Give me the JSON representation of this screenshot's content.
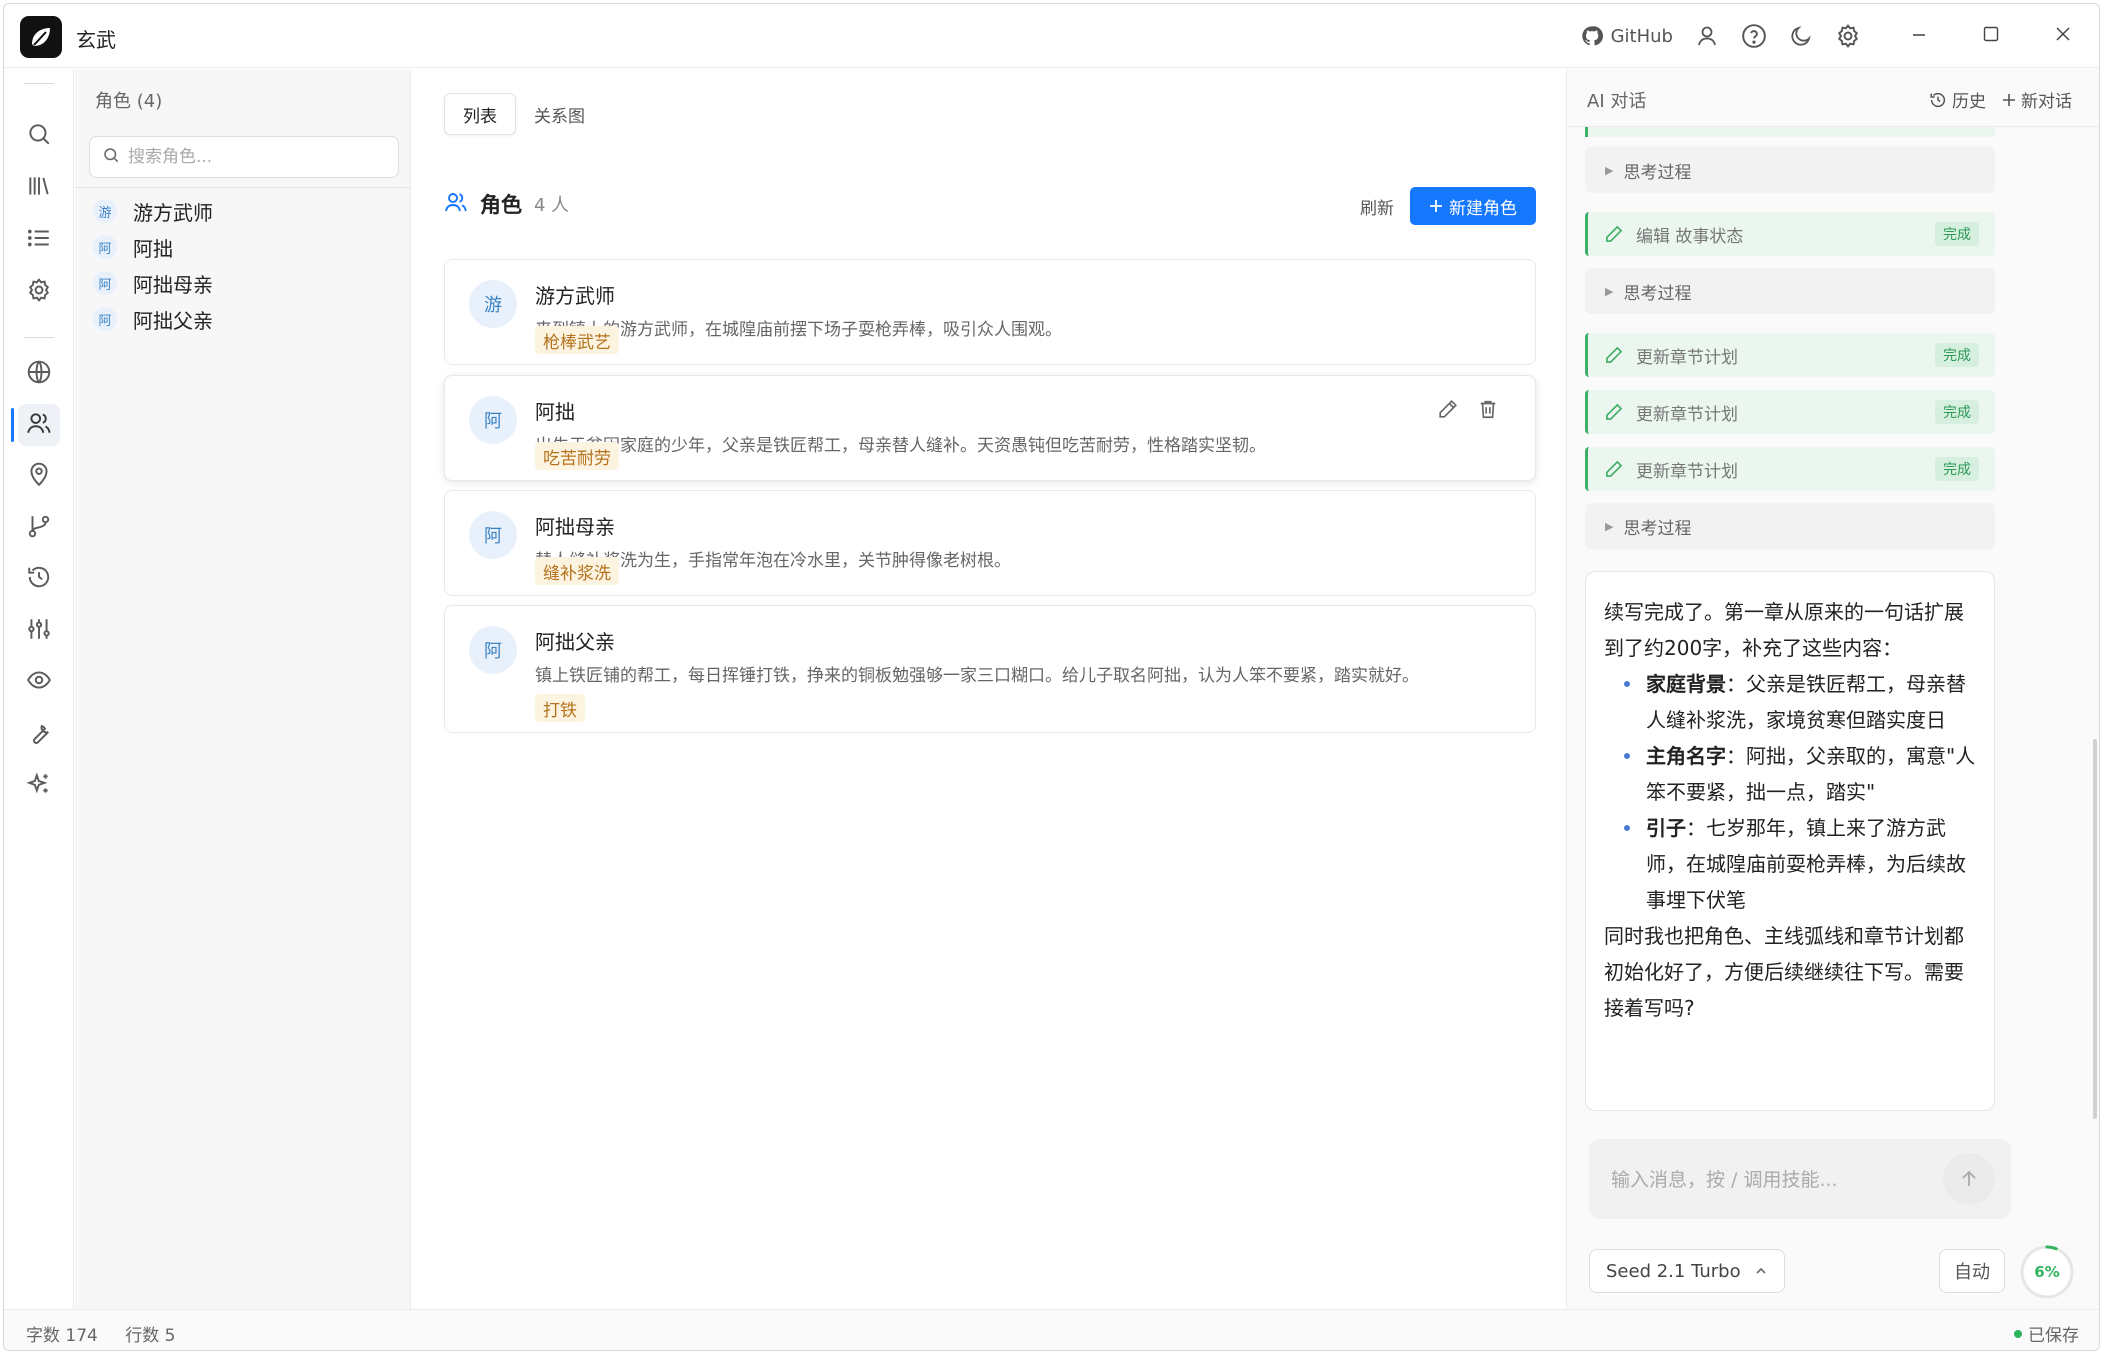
{
  "app": {
    "title": "玄武"
  },
  "titlebar": {
    "github_label": "GitHub"
  },
  "character_list": {
    "header": "角色 (4)",
    "search_placeholder": "搜索角色...",
    "items": [
      {
        "avatar": "游",
        "name": "游方武师"
      },
      {
        "avatar": "阿",
        "name": "阿拙"
      },
      {
        "avatar": "阿",
        "name": "阿拙母亲"
      },
      {
        "avatar": "阿",
        "name": "阿拙父亲"
      }
    ]
  },
  "main": {
    "tabs": [
      {
        "label": "列表",
        "active": true
      },
      {
        "label": "关系图",
        "active": false
      }
    ],
    "section_title": "角色",
    "section_count": "4 人",
    "refresh_label": "刷新",
    "new_button_label": "新建角色",
    "cards": [
      {
        "avatar": "游",
        "name": "游方武师",
        "desc": "来到镇上的游方武师，在城隍庙前摆下场子耍枪弄棒，吸引众人围观。",
        "tag": "枪棒武艺"
      },
      {
        "avatar": "阿",
        "name": "阿拙",
        "desc": "出生于贫困家庭的少年，父亲是铁匠帮工，母亲替人缝补。天资愚钝但吃苦耐劳，性格踏实坚韧。",
        "tag": "吃苦耐劳"
      },
      {
        "avatar": "阿",
        "name": "阿拙母亲",
        "desc": "替人缝补浆洗为生，手指常年泡在冷水里，关节肿得像老树根。",
        "tag": "缝补浆洗"
      },
      {
        "avatar": "阿",
        "name": "阿拙父亲",
        "desc": "镇上铁匠铺的帮工，每日挥锤打铁，挣来的铜板勉强够一家三口糊口。给儿子取名阿拙，认为人笨不要紧，踏实就好。",
        "tag": "打铁"
      }
    ]
  },
  "ai": {
    "title": "AI 对话",
    "history_label": "历史",
    "new_chat_label": "新对话",
    "think_label": "思考过程",
    "done_label": "完成",
    "tool_edit_story": "编辑 故事状态",
    "tool_update_chapter": "更新章节计划",
    "message": {
      "intro": "续写完成了。第一章从原来的一句话扩展到了约200字，补充了这些内容：",
      "bullets": [
        {
          "title": "家庭背景",
          "text": "：父亲是铁匠帮工，母亲替人缝补浆洗，家境贫寒但踏实度日"
        },
        {
          "title": "主角名字",
          "text": "：阿拙，父亲取的，寓意\"人笨不要紧，拙一点，踏实\""
        },
        {
          "title": "引子",
          "text": "：七岁那年，镇上来了游方武师，在城隍庙前耍枪弄棒，为后续故事埋下伏笔"
        }
      ],
      "outro": "同时我也把角色、主线弧线和章节计划都初始化好了，方便后续继续往下写。需要接着写吗?"
    },
    "input_placeholder": "输入消息，按 / 调用技能...",
    "model_label": "Seed 2.1 Turbo",
    "auto_label": "自动",
    "context_percent": "6%",
    "context_fraction": 0.06
  },
  "status": {
    "word_count": "字数 174",
    "line_count": "行数 5",
    "save_state": "已保存"
  },
  "colors": {
    "accent": "#1677ff",
    "tag_bg": "#fdf3e1",
    "tag_text": "#b4731c",
    "success": "#2fb45e"
  }
}
